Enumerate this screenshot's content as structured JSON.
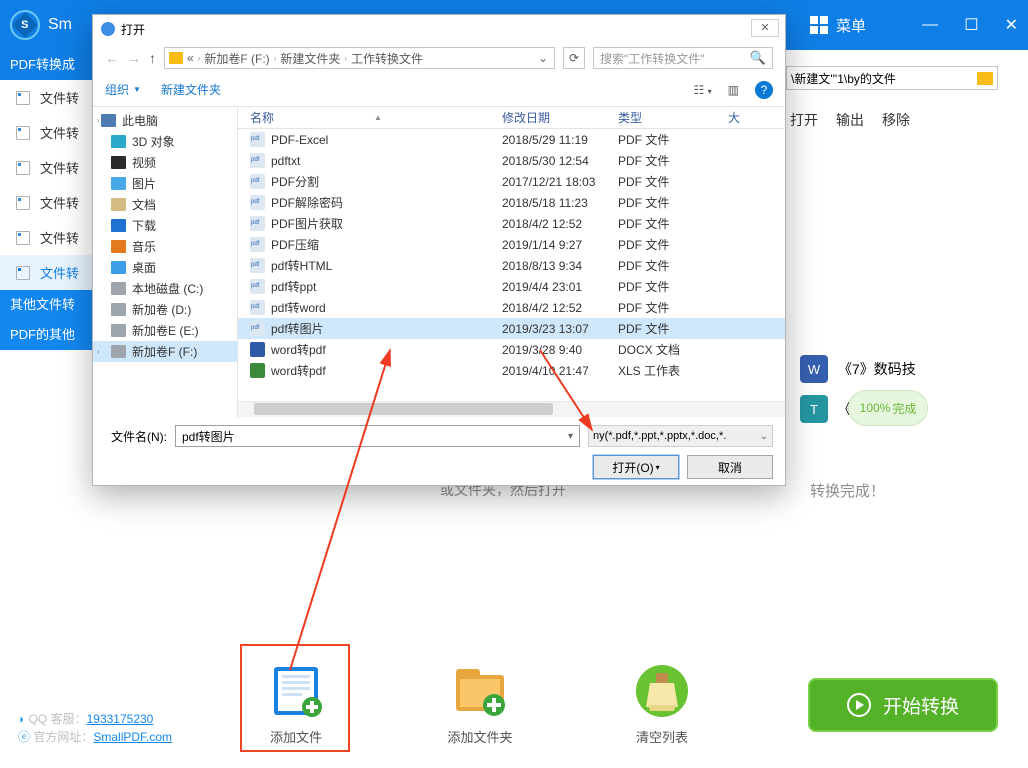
{
  "app": {
    "title_fragment": "Sm",
    "menu_label": "菜单"
  },
  "path_input": "\\新建文'''1\\by的文件",
  "actions": {
    "open": "打开",
    "output": "输出",
    "remove": "移除"
  },
  "sidebar": {
    "head1": "PDF转换成",
    "head2": "其他文件转",
    "head3": "PDF的其他",
    "items": [
      {
        "label": "文件转"
      },
      {
        "label": "文件转"
      },
      {
        "label": "文件转"
      },
      {
        "label": "文件转"
      },
      {
        "label": "文件转"
      },
      {
        "label": "文件转",
        "selected": true
      }
    ]
  },
  "right_tiles": {
    "tile1": "《7》数码技",
    "tile2": "《7》",
    "progress": "100%",
    "progress_label": "完成",
    "done": "转换完成！"
  },
  "footer": {
    "qq_label": "QQ 客服：",
    "qq_link": "1933175230",
    "site_label": "官方网址：",
    "site_link": "SmallPDF.com",
    "add_file": "添加文件",
    "add_folder": "添加文件夹",
    "clear_list": "清空列表",
    "start": "开始转换"
  },
  "dialog": {
    "title": "打开",
    "arrows": {
      "back": "←",
      "fwd": "→",
      "up": "↑"
    },
    "crumbs": [
      "新加卷F (F:)",
      "新建文件夹",
      "工作转换文件"
    ],
    "search_placeholder": "搜索\"工作转换文件\"",
    "toolbar": {
      "org": "组织",
      "newfolder": "新建文件夹"
    },
    "side": [
      {
        "label": "此电脑",
        "lv": 1,
        "color": "#4d7bb2"
      },
      {
        "label": "3D 对象",
        "color": "#2aaac9"
      },
      {
        "label": "视频",
        "color": "#2b2b2b"
      },
      {
        "label": "图片",
        "color": "#49a9e8"
      },
      {
        "label": "文档",
        "color": "#d2bc82"
      },
      {
        "label": "下载",
        "color": "#1e73d2"
      },
      {
        "label": "音乐",
        "color": "#e37a1e"
      },
      {
        "label": "桌面",
        "color": "#3d9ee8"
      },
      {
        "label": "本地磁盘 (C:)",
        "color": "#9ea5ad"
      },
      {
        "label": "新加卷 (D:)",
        "color": "#9ea5ad"
      },
      {
        "label": "新加卷E (E:)",
        "color": "#9ea5ad"
      },
      {
        "label": "新加卷F (F:)",
        "color": "#9ea5ad",
        "selected": true
      }
    ],
    "columns": {
      "name": "名称",
      "date": "修改日期",
      "type": "类型",
      "size": "大"
    },
    "rows": [
      {
        "icon": "pdf",
        "name": "PDF-Excel",
        "date": "2018/5/29 11:19",
        "type": "PDF 文件"
      },
      {
        "icon": "pdf",
        "name": "pdftxt",
        "date": "2018/5/30 12:54",
        "type": "PDF 文件"
      },
      {
        "icon": "pdf",
        "name": "PDF分割",
        "date": "2017/12/21 18:03",
        "type": "PDF 文件"
      },
      {
        "icon": "pdf",
        "name": "PDF解除密码",
        "date": "2018/5/18 11:23",
        "type": "PDF 文件"
      },
      {
        "icon": "pdf",
        "name": "PDF图片获取",
        "date": "2018/4/2 12:52",
        "type": "PDF 文件"
      },
      {
        "icon": "pdf",
        "name": "PDF压缩",
        "date": "2019/1/14 9:27",
        "type": "PDF 文件"
      },
      {
        "icon": "pdf",
        "name": "pdf转HTML",
        "date": "2018/8/13 9:34",
        "type": "PDF 文件"
      },
      {
        "icon": "pdf",
        "name": "pdf转ppt",
        "date": "2019/4/4 23:01",
        "type": "PDF 文件"
      },
      {
        "icon": "pdf",
        "name": "pdf转word",
        "date": "2018/4/2 12:52",
        "type": "PDF 文件"
      },
      {
        "icon": "pdf",
        "name": "pdf转图片",
        "date": "2019/3/23 13:07",
        "type": "PDF 文件",
        "selected": true
      },
      {
        "icon": "docx",
        "name": "word转pdf",
        "date": "2019/3/28 9:40",
        "type": "DOCX 文档"
      },
      {
        "icon": "xls",
        "name": "word转pdf",
        "date": "2019/4/10 21:47",
        "type": "XLS 工作表"
      }
    ],
    "fname_label": "文件名(N):",
    "fname_value": "pdf转图片",
    "ftype_value": "ny(*.pdf,*.ppt,*.pptx,*.doc,*.",
    "open_btn": "打开(O)",
    "cancel_btn": "取消"
  },
  "hidden_text": "或文件夹，然后打开"
}
